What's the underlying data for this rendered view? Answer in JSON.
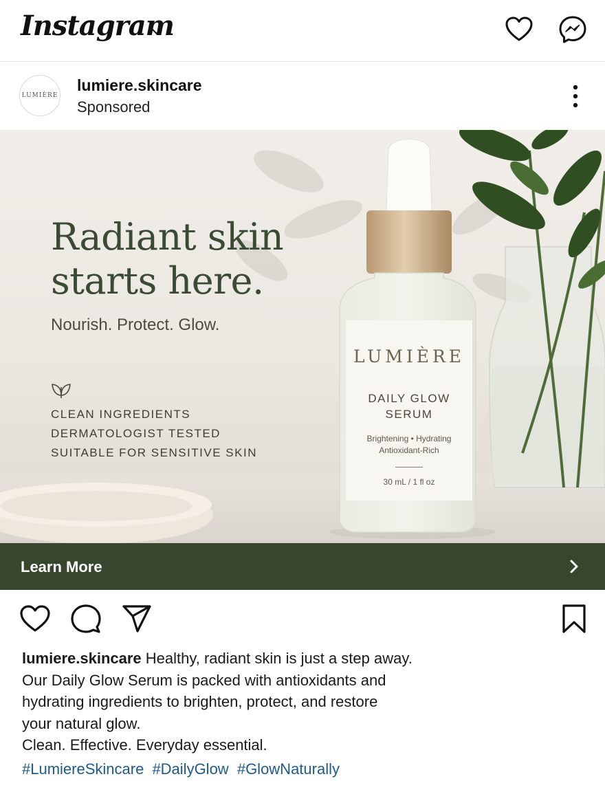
{
  "app": {
    "logo_text": "Instagram"
  },
  "post": {
    "username": "lumiere.skincare",
    "subtitle": "Sponsored",
    "avatar_text": "LUMIÈRE"
  },
  "ad": {
    "headline_line1": "Radiant skin",
    "headline_line2": "starts here.",
    "tagline": "Nourish. Protect. Glow.",
    "features": [
      "CLEAN INGREDIENTS",
      "DERMATOLOGIST TESTED",
      "SUITABLE FOR SENSITIVE SKIN"
    ],
    "label": {
      "brand": "LUMIÈRE",
      "product_line1": "DAILY GLOW",
      "product_line2": "SERUM",
      "attr_line1": "Brightening • Hydrating",
      "attr_line2": "Antioxidant-Rich",
      "size": "30 mL / 1 fl oz"
    },
    "accent_color": "#36472d",
    "headline_color": "#3b4a33"
  },
  "cta": {
    "label": "Learn More"
  },
  "caption": {
    "username": "lumiere.skincare",
    "line1": "Healthy, radiant skin is just a step away.",
    "line2": "Our Daily Glow Serum is packed with antioxidants and",
    "line3": "hydrating ingredients to brighten, protect, and restore",
    "line4": "your natural glow.",
    "line5": "Clean. Effective. Everyday essential.",
    "hashtags": [
      "#LumiereSkincare",
      "#DailyGlow",
      "#GlowNaturally"
    ],
    "hashtag_color": "#1f5a8c"
  },
  "icons": {
    "top": [
      "chevron-down-icon",
      "heart-icon",
      "messenger-icon"
    ],
    "header": [
      "more-options-icon"
    ],
    "actions": [
      "heart-icon",
      "comment-icon",
      "share-icon",
      "bookmark-icon"
    ]
  }
}
